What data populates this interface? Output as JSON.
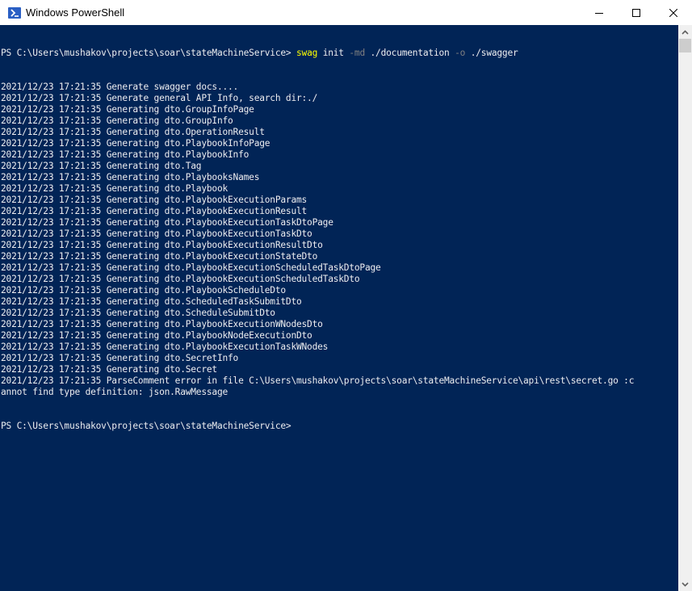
{
  "window": {
    "title": "Windows PowerShell",
    "icon": "powershell-icon",
    "controls": [
      "minimize-icon",
      "maximize-icon",
      "close-icon"
    ]
  },
  "console": {
    "colors": {
      "background": "#012456",
      "foreground": "#eeedf0",
      "command": "#ffff00",
      "parameter": "#808080"
    },
    "command_line": {
      "prompt": "PS C:\\Users\\mushakov\\projects\\soar\\stateMachineService> ",
      "command": "swag",
      "arg1": " init ",
      "flag1": "-md",
      "arg2": " ./documentation ",
      "flag2": "-o",
      "arg3": " ./swagger"
    },
    "output_lines": [
      "2021/12/23 17:21:35 Generate swagger docs....",
      "2021/12/23 17:21:35 Generate general API Info, search dir:./",
      "2021/12/23 17:21:35 Generating dto.GroupInfoPage",
      "2021/12/23 17:21:35 Generating dto.GroupInfo",
      "2021/12/23 17:21:35 Generating dto.OperationResult",
      "2021/12/23 17:21:35 Generating dto.PlaybookInfoPage",
      "2021/12/23 17:21:35 Generating dto.PlaybookInfo",
      "2021/12/23 17:21:35 Generating dto.Tag",
      "2021/12/23 17:21:35 Generating dto.PlaybooksNames",
      "2021/12/23 17:21:35 Generating dto.Playbook",
      "2021/12/23 17:21:35 Generating dto.PlaybookExecutionParams",
      "2021/12/23 17:21:35 Generating dto.PlaybookExecutionResult",
      "2021/12/23 17:21:35 Generating dto.PlaybookExecutionTaskDtoPage",
      "2021/12/23 17:21:35 Generating dto.PlaybookExecutionTaskDto",
      "2021/12/23 17:21:35 Generating dto.PlaybookExecutionResultDto",
      "2021/12/23 17:21:35 Generating dto.PlaybookExecutionStateDto",
      "2021/12/23 17:21:35 Generating dto.PlaybookExecutionScheduledTaskDtoPage",
      "2021/12/23 17:21:35 Generating dto.PlaybookExecutionScheduledTaskDto",
      "2021/12/23 17:21:35 Generating dto.PlaybookScheduleDto",
      "2021/12/23 17:21:35 Generating dto.ScheduledTaskSubmitDto",
      "2021/12/23 17:21:35 Generating dto.ScheduleSubmitDto",
      "2021/12/23 17:21:35 Generating dto.PlaybookExecutionWNodesDto",
      "2021/12/23 17:21:35 Generating dto.PlaybookNodeExecutionDto",
      "2021/12/23 17:21:35 Generating dto.PlaybookExecutionTaskWNodes",
      "2021/12/23 17:21:35 Generating dto.SecretInfo",
      "2021/12/23 17:21:35 Generating dto.Secret",
      "2021/12/23 17:21:35 ParseComment error in file C:\\Users\\mushakov\\projects\\soar\\stateMachineService\\api\\rest\\secret.go :c",
      "annot find type definition: json.RawMessage"
    ],
    "final_prompt": "PS C:\\Users\\mushakov\\projects\\soar\\stateMachineService>"
  },
  "scrollbar": {
    "up_icon": "chevron-up-icon",
    "down_icon": "chevron-down-icon"
  }
}
